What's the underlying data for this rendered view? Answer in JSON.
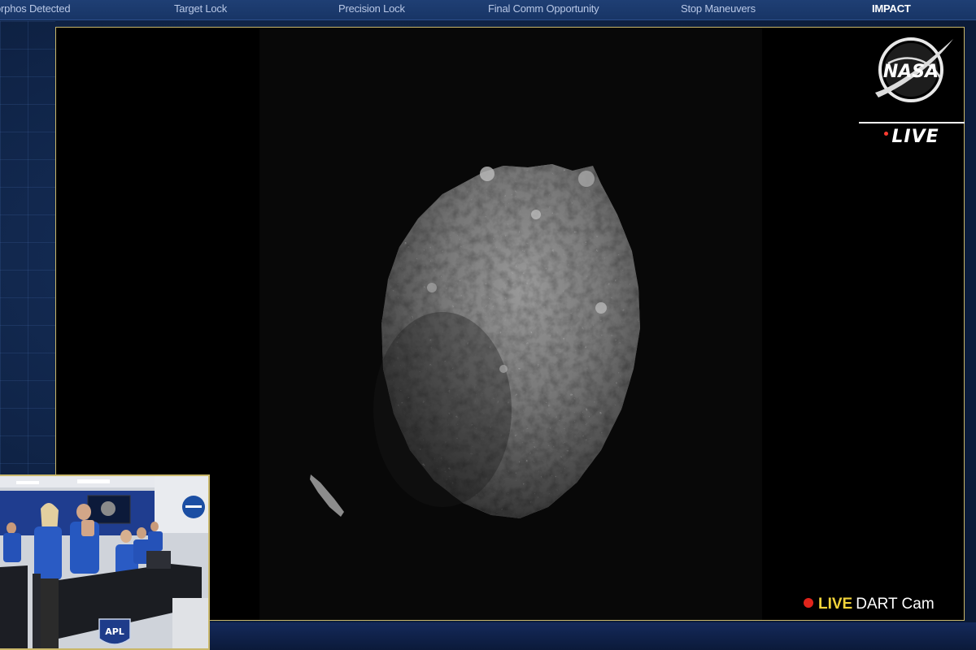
{
  "timeline": {
    "milestones": [
      {
        "label": "Didymos & Dimorphos Detected",
        "visible_label": "orphos Detected"
      },
      {
        "label": "Target Lock"
      },
      {
        "label": "Precision Lock"
      },
      {
        "label": "Final Comm Opportunity"
      },
      {
        "label": "Stop Maneuvers"
      },
      {
        "label": "IMPACT",
        "active": true
      }
    ]
  },
  "overlay": {
    "live_badge": "LIVE",
    "cam_live": "LIVE",
    "cam_name": "DART Cam"
  },
  "logos": {
    "agency": "NASA",
    "lab": "APL"
  },
  "icons": {
    "nasa": "nasa-meatball-icon",
    "record": "record-dot-icon"
  },
  "colors": {
    "frame_border": "#c9b76a",
    "live_yellow": "#f2d43a",
    "record_red": "#e0241b",
    "timeline_bg": "#1f3f74"
  }
}
